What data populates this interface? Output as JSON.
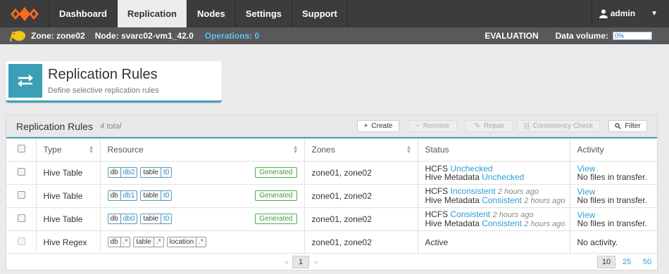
{
  "nav": {
    "tabs": [
      {
        "label": "Dashboard"
      },
      {
        "label": "Replication"
      },
      {
        "label": "Nodes"
      },
      {
        "label": "Settings"
      },
      {
        "label": "Support"
      }
    ],
    "active": "Replication",
    "user": "admin"
  },
  "status": {
    "zone": "Zone: zone02",
    "node": "Node: svarc02-vm1_42.0",
    "operations": "Operations: 0",
    "edition": "EVALUATION",
    "data_volume_label": "Data volume:",
    "data_volume": "0%"
  },
  "header": {
    "title": "Replication Rules",
    "subtitle": "Define selective replication rules"
  },
  "panel": {
    "title": "Replication Rules",
    "count": "4 total",
    "buttons": {
      "create": "Create",
      "remove": "Remove",
      "repair": "Repair",
      "consistency": "Consistency Check",
      "filter": "Filter"
    }
  },
  "table": {
    "headers": {
      "type": "Type",
      "resource": "Resource",
      "zones": "Zones",
      "status": "Status",
      "activity": "Activity"
    },
    "rows": [
      {
        "type": "Hive Table",
        "tags": [
          {
            "k": "db",
            "v": "db2"
          },
          {
            "k": "table",
            "v": "t0"
          }
        ],
        "generated": "Generated",
        "zones": "zone01, zone02",
        "s1_label": "HCFS",
        "s1_value": "Unchecked",
        "s1_ago": "",
        "s2_label": "Hive Metadata",
        "s2_value": "Unchecked",
        "s2_ago": "",
        "activity_link": "View",
        "activity": "No files in transfer."
      },
      {
        "type": "Hive Table",
        "tags": [
          {
            "k": "db",
            "v": "db1"
          },
          {
            "k": "table",
            "v": "t0"
          }
        ],
        "generated": "Generated",
        "zones": "zone01, zone02",
        "s1_label": "HCFS",
        "s1_value": "Inconsistent",
        "s1_ago": "2 hours ago",
        "s2_label": "Hive Metadata",
        "s2_value": "Consistent",
        "s2_ago": "2 hours ago",
        "activity_link": "View",
        "activity": "No files in transfer."
      },
      {
        "type": "Hive Table",
        "tags": [
          {
            "k": "db",
            "v": "db0"
          },
          {
            "k": "table",
            "v": "t0"
          }
        ],
        "generated": "Generated",
        "zones": "zone01, zone02",
        "s1_label": "HCFS",
        "s1_value": "Consistent",
        "s1_ago": "2 hours ago",
        "s2_label": "Hive Metadata",
        "s2_value": "Consistent",
        "s2_ago": "2 hours ago",
        "activity_link": "View",
        "activity": "No files in transfer."
      },
      {
        "type": "Hive Regex",
        "tags": [
          {
            "k": "db",
            "v": ".*"
          },
          {
            "k": "table",
            "v": ".*"
          },
          {
            "k": "location",
            "v": ".*"
          }
        ],
        "zones": "zone01, zone02",
        "status": "Active",
        "activity": "No activity."
      }
    ]
  },
  "pager": {
    "prev": "«",
    "current": "1",
    "next": "»",
    "sizes": [
      "10",
      "25",
      "50"
    ]
  }
}
